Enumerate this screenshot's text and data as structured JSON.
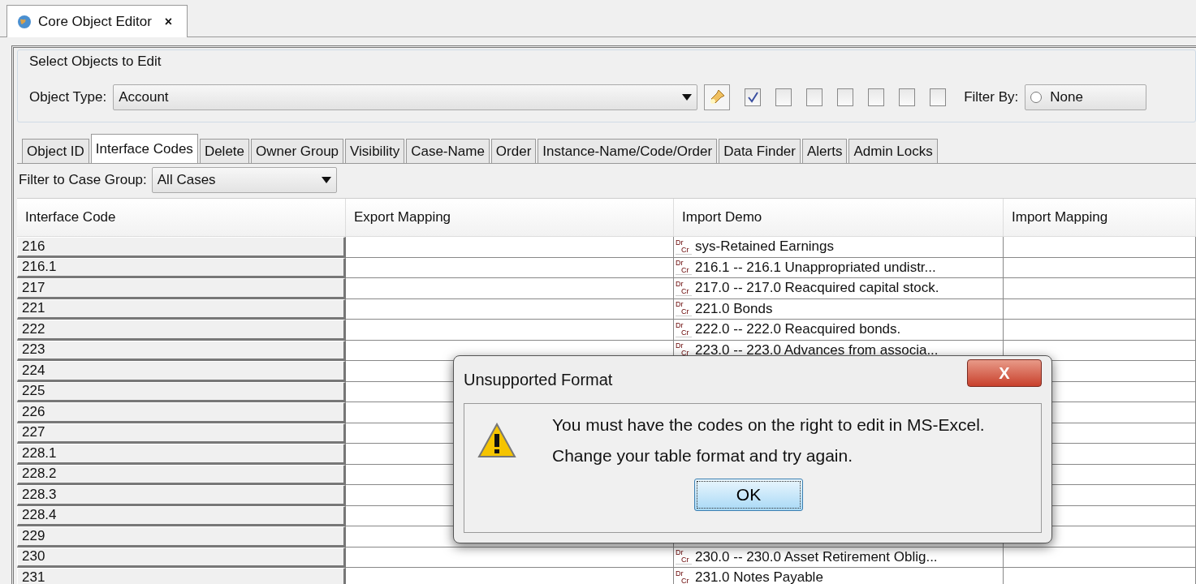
{
  "doc_tab": {
    "title": "Core Object Editor",
    "close": "×",
    "selected": true
  },
  "select_group": {
    "title": "Select Objects to Edit",
    "object_type_label": "Object Type:",
    "object_type_value": "Account",
    "checkboxes": [
      {
        "checked": true
      },
      {
        "checked": false
      },
      {
        "checked": false
      },
      {
        "checked": false
      },
      {
        "checked": false
      },
      {
        "checked": false
      },
      {
        "checked": false
      }
    ],
    "filter_by_label": "Filter By:",
    "filter_option": {
      "label": "None",
      "selected": false
    }
  },
  "tabs": [
    {
      "label": "Object ID",
      "selected": false
    },
    {
      "label": "Interface Codes",
      "selected": true
    },
    {
      "label": "Delete",
      "selected": false
    },
    {
      "label": "Owner Group",
      "selected": false
    },
    {
      "label": "Visibility",
      "selected": false
    },
    {
      "label": "Case-Name",
      "selected": false
    },
    {
      "label": "Order",
      "selected": false
    },
    {
      "label": "Instance-Name/Code/Order",
      "selected": false
    },
    {
      "label": "Data Finder",
      "selected": false
    },
    {
      "label": "Alerts",
      "selected": false
    },
    {
      "label": "Admin Locks",
      "selected": false
    }
  ],
  "case_filter": {
    "label": "Filter to Case Group:",
    "value": "All Cases"
  },
  "table": {
    "columns": [
      "Interface Code",
      "Export Mapping",
      "Import Demo",
      "Import Mapping"
    ],
    "rows": [
      {
        "code": "216",
        "demo_icon": [
          "Dr",
          "Cr"
        ],
        "import_demo": "sys-Retained Earnings"
      },
      {
        "code": "216.1",
        "demo_icon": [
          "Dr",
          "Cr"
        ],
        "import_demo": "216.1 -- 216.1 Unappropriated undistr..."
      },
      {
        "code": "217",
        "demo_icon": [
          "Dr",
          "Cr"
        ],
        "import_demo": "217.0 -- 217.0 Reacquired capital stock."
      },
      {
        "code": "221",
        "demo_icon": [
          "Dr",
          "Cr"
        ],
        "import_demo": "221.0 Bonds"
      },
      {
        "code": "222",
        "demo_icon": [
          "Dr",
          "Cr"
        ],
        "import_demo": "222.0 -- 222.0 Reacquired bonds."
      },
      {
        "code": "223",
        "demo_icon": [
          "Dr",
          "Cr"
        ],
        "import_demo": "223.0 -- 223.0 Advances from associa..."
      },
      {
        "code": "224"
      },
      {
        "code": "225"
      },
      {
        "code": "226"
      },
      {
        "code": "227"
      },
      {
        "code": "228.1"
      },
      {
        "code": "228.2"
      },
      {
        "code": "228.3"
      },
      {
        "code": "228.4"
      },
      {
        "code": "229"
      },
      {
        "code": "230",
        "demo_icon": [
          "Dr",
          "Cr"
        ],
        "import_demo": "230.0 -- 230.0 Asset Retirement Oblig..."
      },
      {
        "code": "231",
        "demo_icon": [
          "Dr",
          "Cr"
        ],
        "import_demo": "231.0 Notes Payable"
      }
    ]
  },
  "dialog": {
    "title": "Unsupported Format",
    "close": "X",
    "lines": [
      "You must have the codes on the right to edit in MS-Excel.",
      "Change your table format and try again."
    ],
    "button": "OK"
  }
}
